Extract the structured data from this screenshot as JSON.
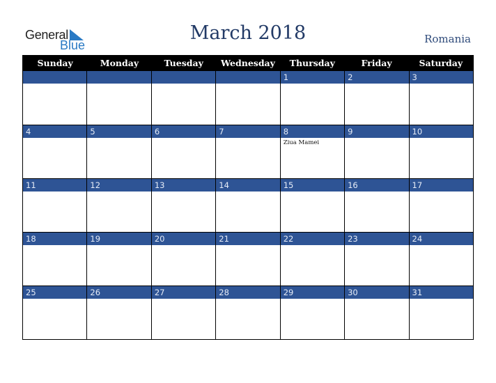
{
  "logo": {
    "line1": "General",
    "line2": "Blue",
    "icon": "triangle-flag-icon",
    "accent": "#2a7ac4"
  },
  "title": "March 2018",
  "country": "Romania",
  "colors": {
    "header_bg": "#000000",
    "band": "#2e5495",
    "title": "#223a66"
  },
  "weekdays": [
    "Sunday",
    "Monday",
    "Tuesday",
    "Wednesday",
    "Thursday",
    "Friday",
    "Saturday"
  ],
  "weeks": [
    [
      {
        "day": ""
      },
      {
        "day": ""
      },
      {
        "day": ""
      },
      {
        "day": ""
      },
      {
        "day": "1"
      },
      {
        "day": "2"
      },
      {
        "day": "3"
      }
    ],
    [
      {
        "day": "4"
      },
      {
        "day": "5"
      },
      {
        "day": "6"
      },
      {
        "day": "7"
      },
      {
        "day": "8",
        "event": "Ziua Mamei"
      },
      {
        "day": "9"
      },
      {
        "day": "10"
      }
    ],
    [
      {
        "day": "11"
      },
      {
        "day": "12"
      },
      {
        "day": "13"
      },
      {
        "day": "14"
      },
      {
        "day": "15"
      },
      {
        "day": "16"
      },
      {
        "day": "17"
      }
    ],
    [
      {
        "day": "18"
      },
      {
        "day": "19"
      },
      {
        "day": "20"
      },
      {
        "day": "21"
      },
      {
        "day": "22"
      },
      {
        "day": "23"
      },
      {
        "day": "24"
      }
    ],
    [
      {
        "day": "25"
      },
      {
        "day": "26"
      },
      {
        "day": "27"
      },
      {
        "day": "28"
      },
      {
        "day": "29"
      },
      {
        "day": "30"
      },
      {
        "day": "31"
      }
    ]
  ]
}
